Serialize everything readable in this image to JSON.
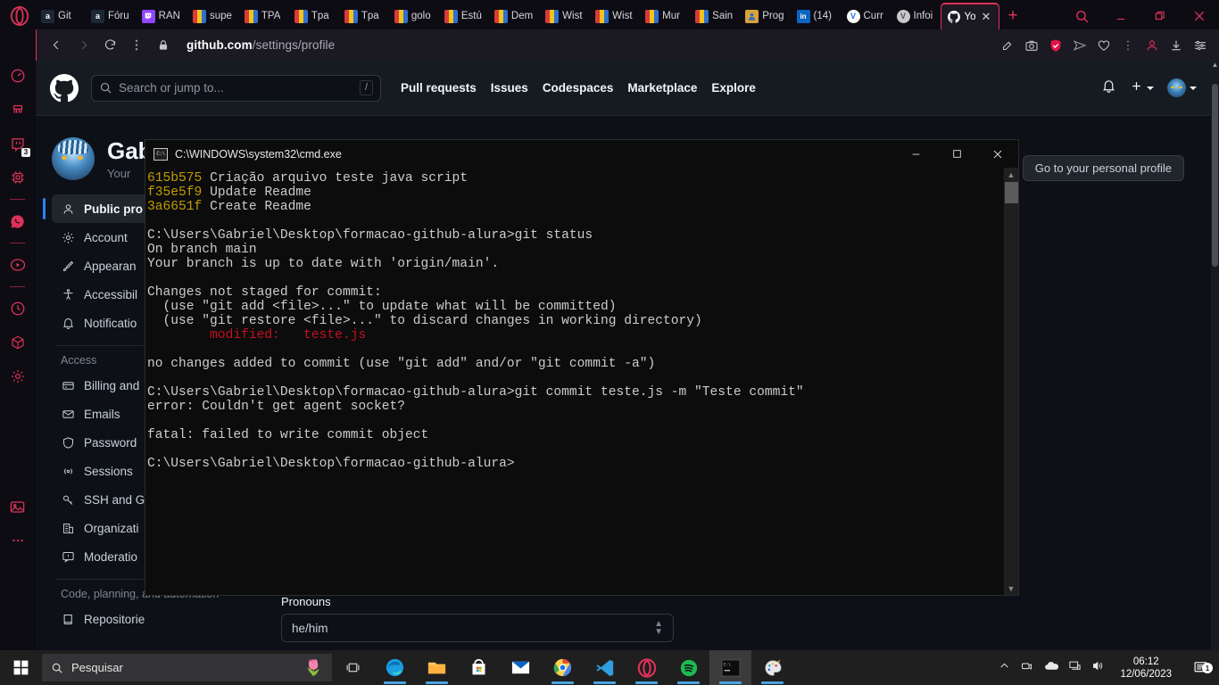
{
  "browser": {
    "tabs": [
      {
        "label": "Git ",
        "favicon": "amazon-icon",
        "fav_bg": "#1b2838",
        "fav_text": "a"
      },
      {
        "label": "Fóru",
        "favicon": "amazon-icon",
        "fav_bg": "#1b2838",
        "fav_text": "a"
      },
      {
        "label": "RAN",
        "favicon": "twitch-icon",
        "fav_bg": "#9146ff",
        "fav_text": ""
      },
      {
        "label": "supe",
        "favicon": "bookmark-icon",
        "fav_bg": "#e8e8e8",
        "fav_text": ""
      },
      {
        "label": "TPA",
        "favicon": "bookmark-icon",
        "fav_bg": "#e8e8e8",
        "fav_text": ""
      },
      {
        "label": "Tpa",
        "favicon": "bookmark-icon",
        "fav_bg": "#e8e8e8",
        "fav_text": ""
      },
      {
        "label": "Tpa",
        "favicon": "bookmark-icon",
        "fav_bg": "#e8e8e8",
        "fav_text": ""
      },
      {
        "label": "golo",
        "favicon": "bookmark-icon",
        "fav_bg": "#e8e8e8",
        "fav_text": ""
      },
      {
        "label": "Estú",
        "favicon": "bookmark-icon",
        "fav_bg": "#e8e8e8",
        "fav_text": ""
      },
      {
        "label": "Dem",
        "favicon": "bookmark-icon",
        "fav_bg": "#e8e8e8",
        "fav_text": ""
      },
      {
        "label": "Wist",
        "favicon": "bookmark-icon",
        "fav_bg": "#e8e8e8",
        "fav_text": ""
      },
      {
        "label": "Wist",
        "favicon": "bookmark-icon",
        "fav_bg": "#e8e8e8",
        "fav_text": ""
      },
      {
        "label": "Mur",
        "favicon": "bookmark-icon",
        "fav_bg": "#e8e8e8",
        "fav_text": ""
      },
      {
        "label": "Sain",
        "favicon": "bookmark-icon",
        "fav_bg": "#e8e8e8",
        "fav_text": ""
      },
      {
        "label": "Prog",
        "favicon": "program-icon",
        "fav_bg": "#d8a13a",
        "fav_text": ""
      },
      {
        "label": "(14)",
        "favicon": "linkedin-icon",
        "fav_bg": "#0a66c2",
        "fav_text": "in"
      },
      {
        "label": "Curr",
        "favicon": "v-circle-icon",
        "fav_bg": "#1f6feb",
        "fav_text": "V"
      },
      {
        "label": "Infoi",
        "favicon": "v-circle-grey-icon",
        "fav_bg": "#8b949e",
        "fav_text": "V"
      }
    ],
    "active_tab": {
      "label": "Yo",
      "favicon": "github-icon"
    },
    "new_tab_label": "+",
    "window_controls": {
      "search": "search-icon",
      "minimize": "_",
      "restore": "restore-icon",
      "close": "close-icon"
    },
    "address": {
      "back": "back-arrow-icon",
      "forward": "forward-arrow-icon",
      "reload": "reload-icon",
      "menu": "kebab-menu-icon",
      "lock": "lock-icon",
      "host": "github.com",
      "path": "/settings/profile"
    },
    "address_right_icons": [
      "pin-edit-icon",
      "camera-snapshot-icon",
      "vpn-shield-icon",
      "send-icon",
      "heart-icon",
      "kebab-menu-icon",
      "profile-icon",
      "download-icon",
      "settings-sliders-icon"
    ],
    "sidebar_icons": [
      {
        "name": "speed-dial-icon",
        "badge": ""
      },
      {
        "name": "cleaner-icon",
        "badge": ""
      },
      {
        "name": "twitch-icon",
        "badge": "3"
      },
      {
        "name": "cpu-ram-icon",
        "badge": ""
      },
      {
        "name": "separator",
        "badge": ""
      },
      {
        "name": "whatsapp-icon",
        "badge": ""
      },
      {
        "name": "separator",
        "badge": ""
      },
      {
        "name": "player-icon",
        "badge": ""
      },
      {
        "name": "separator",
        "badge": ""
      },
      {
        "name": "history-clock-icon",
        "badge": ""
      },
      {
        "name": "box-package-icon",
        "badge": ""
      },
      {
        "name": "gear-settings-icon",
        "badge": ""
      },
      {
        "name": "gallery-image-icon",
        "badge": ""
      },
      {
        "name": "more-dots-icon",
        "badge": ""
      }
    ]
  },
  "github": {
    "search_placeholder": "Search or jump to...",
    "search_shortcut": "/",
    "nav": [
      "Pull requests",
      "Issues",
      "Codespaces",
      "Marketplace",
      "Explore"
    ],
    "header_right": {
      "bell": "notification-bell-icon",
      "plus": "+",
      "avatar": "user-avatar"
    },
    "profile": {
      "name": "Gab",
      "subtitle": "Your",
      "personal_profile_button": "Go to your personal profile"
    },
    "sidebar": {
      "items": [
        {
          "label": "Public pro",
          "icon": "person-icon",
          "active": true
        },
        {
          "label": "Account",
          "icon": "gear-icon",
          "active": false
        },
        {
          "label": "Appearan",
          "icon": "paintbrush-icon",
          "active": false
        },
        {
          "label": "Accessibil",
          "icon": "accessibility-icon",
          "active": false
        },
        {
          "label": "Notificatio",
          "icon": "bell-icon",
          "active": false
        }
      ],
      "access_group": "Access",
      "access_items": [
        {
          "label": "Billing and",
          "icon": "credit-card-icon"
        },
        {
          "label": "Emails",
          "icon": "mail-icon"
        },
        {
          "label": "Password",
          "icon": "shield-icon"
        },
        {
          "label": "Sessions",
          "icon": "broadcast-icon"
        },
        {
          "label": "SSH and G",
          "icon": "key-icon"
        },
        {
          "label": "Organizati",
          "icon": "organization-icon"
        },
        {
          "label": "Moderatio",
          "icon": "report-icon"
        }
      ],
      "code_group": "Code, planning, and automation",
      "code_items": [
        {
          "label": "Repositorie",
          "icon": "repo-icon"
        }
      ]
    },
    "main": {
      "pronouns_label": "Pronouns",
      "pronouns_value": "he/him"
    }
  },
  "cmd": {
    "title": "C:\\WINDOWS\\system32\\cmd.exe",
    "icon": "cmd-icon",
    "controls": {
      "minimize": "minimize-icon",
      "maximize": "maximize-icon",
      "close": "close-icon"
    },
    "lines": [
      [
        {
          "t": "615b575",
          "c": "yellow"
        },
        {
          "t": " Criação arquivo teste java script",
          "c": ""
        }
      ],
      [
        {
          "t": "f35e5f9",
          "c": "yellow"
        },
        {
          "t": " Update Readme",
          "c": ""
        }
      ],
      [
        {
          "t": "3a6651f",
          "c": "yellow"
        },
        {
          "t": " Create Readme",
          "c": ""
        }
      ],
      [
        {
          "t": "",
          "c": ""
        }
      ],
      [
        {
          "t": "C:\\Users\\Gabriel\\Desktop\\formacao-github-alura>git status",
          "c": ""
        }
      ],
      [
        {
          "t": "On branch main",
          "c": ""
        }
      ],
      [
        {
          "t": "Your branch is up to date with 'origin/main'.",
          "c": ""
        }
      ],
      [
        {
          "t": "",
          "c": ""
        }
      ],
      [
        {
          "t": "Changes not staged for commit:",
          "c": ""
        }
      ],
      [
        {
          "t": "  (use \"git add <file>...\" to update what will be committed)",
          "c": ""
        }
      ],
      [
        {
          "t": "  (use \"git restore <file>...\" to discard changes in working directory)",
          "c": ""
        }
      ],
      [
        {
          "t": "        modified:   teste.js",
          "c": "red"
        }
      ],
      [
        {
          "t": "",
          "c": ""
        }
      ],
      [
        {
          "t": "no changes added to commit (use \"git add\" and/or \"git commit -a\")",
          "c": ""
        }
      ],
      [
        {
          "t": "",
          "c": ""
        }
      ],
      [
        {
          "t": "C:\\Users\\Gabriel\\Desktop\\formacao-github-alura>git commit teste.js -m \"Teste commit\"",
          "c": ""
        }
      ],
      [
        {
          "t": "error: Couldn't get agent socket?",
          "c": ""
        }
      ],
      [
        {
          "t": "",
          "c": ""
        }
      ],
      [
        {
          "t": "fatal: failed to write commit object",
          "c": ""
        }
      ],
      [
        {
          "t": "",
          "c": ""
        }
      ],
      [
        {
          "t": "C:\\Users\\Gabriel\\Desktop\\formacao-github-alura>",
          "c": ""
        }
      ]
    ]
  },
  "taskbar": {
    "start": "windows-start-icon",
    "search_placeholder": "Pesquisar",
    "search_decoration": "🌷",
    "task_view": "task-view-icon",
    "apps": [
      {
        "name": "edge-icon",
        "running": true,
        "focused": false
      },
      {
        "name": "file-explorer-icon",
        "running": true,
        "focused": false
      },
      {
        "name": "microsoft-store-icon",
        "running": false,
        "focused": false
      },
      {
        "name": "mail-icon",
        "running": false,
        "focused": false
      },
      {
        "name": "chrome-icon",
        "running": true,
        "focused": false
      },
      {
        "name": "vscode-icon",
        "running": true,
        "focused": false
      },
      {
        "name": "opera-icon",
        "running": true,
        "focused": false
      },
      {
        "name": "spotify-icon",
        "running": true,
        "focused": false
      },
      {
        "name": "cmd-icon",
        "running": true,
        "focused": true
      },
      {
        "name": "paint-icon",
        "running": true,
        "focused": false
      }
    ],
    "tray": [
      "chevron-up-icon",
      "camera-device-icon",
      "onedrive-icon",
      "network-icon",
      "volume-icon"
    ],
    "clock_time": "06:12",
    "clock_date": "12/06/2023",
    "notification_count": "1"
  }
}
